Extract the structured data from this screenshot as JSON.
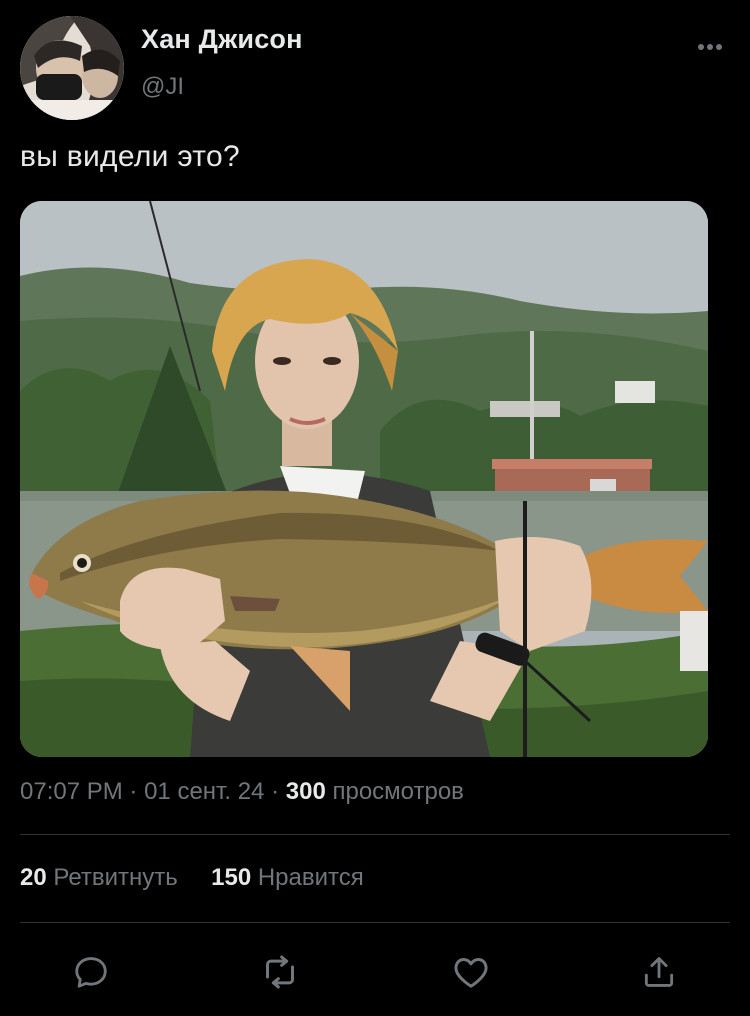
{
  "author": {
    "name": "Хан Джисон",
    "handle": "@JI"
  },
  "tweet": {
    "text": "вы видели это?"
  },
  "meta": {
    "time": "07:07 PM",
    "separator": "·",
    "date": "01 сент. 24",
    "views_count": "300",
    "views_label": "просмотров"
  },
  "stats": {
    "retweets_count": "20",
    "retweets_label": "Ретвитнуть",
    "likes_count": "150",
    "likes_label": "Нравится"
  },
  "actions": {
    "reply_icon": "reply-icon",
    "retweet_icon": "retweet-icon",
    "like_icon": "heart-icon",
    "share_icon": "share-icon",
    "more_icon": "more-icon"
  },
  "colors": {
    "background": "#000000",
    "text_primary": "#e7e9ea",
    "text_secondary": "#71767b",
    "divider": "#2f3336"
  }
}
